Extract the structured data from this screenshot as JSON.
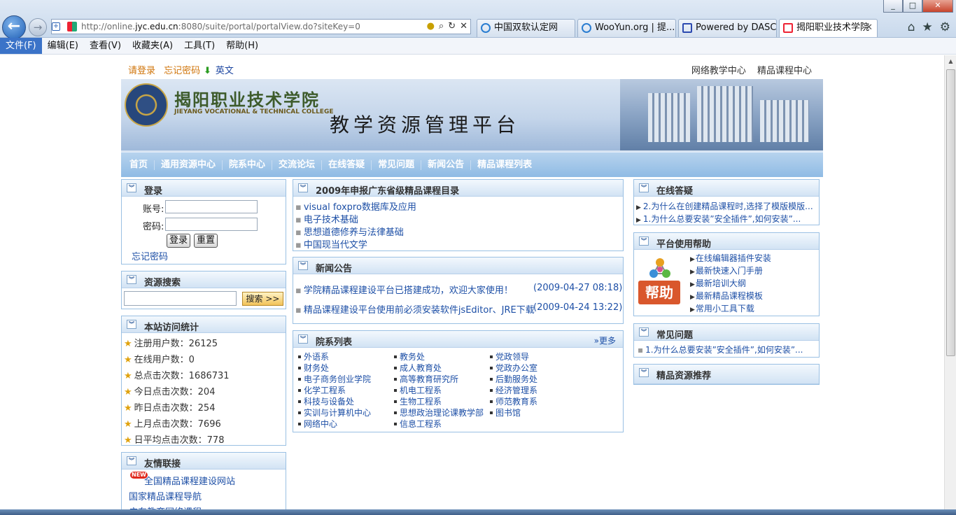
{
  "browser": {
    "url_prefix": "http://online.",
    "url_domain": "jyc.edu.cn",
    "url_rest": ":8080/suite/portal/portalView.do?siteKey=0",
    "tabs": [
      {
        "label": "中国双软认定网"
      },
      {
        "label": "WooYun.org | 提..."
      },
      {
        "label": "Powered by DASC..."
      },
      {
        "label": "揭阳职业技术学院"
      }
    ],
    "menu": [
      "文件(F)",
      "编辑(E)",
      "查看(V)",
      "收藏夹(A)",
      "工具(T)",
      "帮助(H)"
    ]
  },
  "topbar": {
    "login": "请登录",
    "forgot": "忘记密码",
    "english": "英文",
    "links": [
      "网络教学中心",
      "精品课程中心"
    ]
  },
  "banner": {
    "school_cn": "揭阳职业技术学院",
    "school_en": "JIEYANG VOCATIONAL & TECHNICAL COLLEGE",
    "platform": "教学资源管理平台"
  },
  "nav": [
    "首页",
    "通用资源中心",
    "院系中心",
    "交流论坛",
    "在线答疑",
    "常见问题",
    "新闻公告",
    "精品课程列表"
  ],
  "login_panel": {
    "title": "登录",
    "account_label": "账号:",
    "password_label": "密码:",
    "login_btn": "登录",
    "reset_btn": "重置",
    "forgot": "忘记密码"
  },
  "search_panel": {
    "title": "资源搜索",
    "button": "搜索 >>"
  },
  "stats_panel": {
    "title": "本站访问统计",
    "items": [
      "注册用户数：26125",
      "在线用户数：0",
      "总点击次数：1686731",
      "今日点击次数：204",
      "昨日点击次数：254",
      "上月点击次数：7696",
      "日平均点击次数：778"
    ]
  },
  "links_panel": {
    "title": "友情联接",
    "new_badge": "NEW",
    "items": [
      "全国精品课程建设网站",
      "国家精品课程导航",
      "广东教育网络课程"
    ]
  },
  "courses_panel": {
    "title": "2009年申报广东省级精品课程目录",
    "items": [
      "visual foxpro数据库及应用",
      "电子技术基础",
      "思想道德修养与法律基础",
      "中国现当代文学"
    ]
  },
  "news_panel": {
    "title": "新闻公告",
    "items": [
      {
        "text": "学院精品课程建设平台已搭建成功，欢迎大家使用！",
        "date": "(2009-04-27 08:18)"
      },
      {
        "text": "精品课程建设平台使用前必须安装软件jsEditor、JRE下载",
        "date": "(2009-04-24 13:22)"
      }
    ]
  },
  "depts_panel": {
    "title": "院系列表",
    "more": "»更多",
    "col1": [
      "外语系",
      "财务处",
      "电子商务创业学院",
      "化学工程系",
      "科技与设备处",
      "实训与计算机中心",
      "网络中心"
    ],
    "col2": [
      "教务处",
      "成人教育处",
      "高等教育研究所",
      "机电工程系",
      "生物工程系",
      "思想政治理论课教学部",
      "信息工程系"
    ],
    "col3": [
      "党政领导",
      "党政办公室",
      "后勤服务处",
      "经济管理系",
      "师范教育系",
      "图书馆"
    ]
  },
  "qa_panel": {
    "title": "在线答疑",
    "items": [
      "2.为什么在创建精品课程时,选择了模版模版...",
      "1.为什么总要安装”安全插件”,如何安装”..."
    ]
  },
  "help_panel": {
    "title": "平台使用帮助",
    "image_text": "帮助",
    "items": [
      "在线编辑器插件安装",
      "最新快速入门手册",
      "最新培训大纲",
      "最新精品课程模板",
      "常用小工具下载"
    ]
  },
  "faq_panel": {
    "title": "常见问题",
    "items": [
      "1.为什么总要安装”安全插件”,如何安装”..."
    ]
  },
  "recommend_panel": {
    "title": "精品资源推荐"
  },
  "colors": {
    "link": "#1d4fa6",
    "accent_orange": "#d0750b",
    "nav_blue": "#8fbbe4",
    "panel_border": "#9ac0e3"
  }
}
